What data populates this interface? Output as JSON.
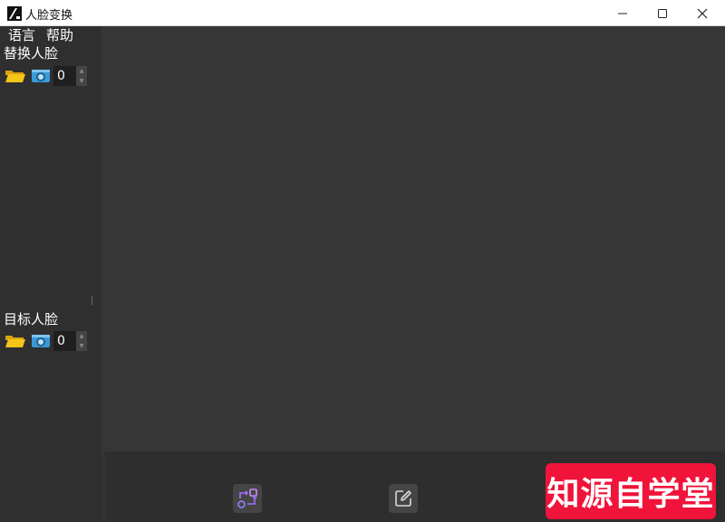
{
  "window": {
    "title": "人脸变换",
    "icon": "app-logo-icon"
  },
  "menu": {
    "items": [
      "语言",
      "帮助"
    ]
  },
  "source_face": {
    "title": "替换人脸",
    "count": "0",
    "folder_icon": "folder-icon",
    "camera_icon": "camera-icon"
  },
  "target_face": {
    "title": "目标人脸",
    "count": "0",
    "folder_icon": "folder-icon",
    "camera_icon": "camera-icon"
  },
  "toolbar": {
    "swap_icon": "swap-icon",
    "edit_icon": "edit-icon"
  },
  "watermark": {
    "text": "知源自学堂"
  },
  "colors": {
    "badge": "#f0133a",
    "folder": "#f5c518",
    "camera": "#3a9ad9",
    "swap_accent": "#a070ff"
  }
}
